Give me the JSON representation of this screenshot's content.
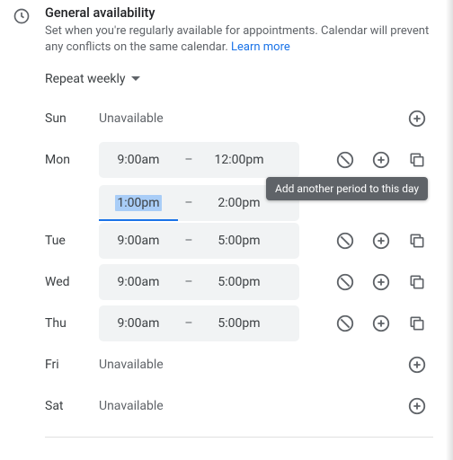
{
  "header": {
    "title": "General availability",
    "subtitle_prefix": "Set when you're regularly available for appointments. Calendar will prevent any conflicts on the same calendar. ",
    "learn_more": "Learn more"
  },
  "repeat": {
    "label": "Repeat weekly"
  },
  "tooltip": {
    "add_period": "Add another period to this day"
  },
  "dash": "–",
  "days": {
    "sun": {
      "label": "Sun",
      "unavailable": "Unavailable"
    },
    "mon": {
      "label": "Mon",
      "periods": [
        {
          "start": "9:00am",
          "end": "12:00pm"
        },
        {
          "start": "1:00pm",
          "end": "2:00pm"
        }
      ]
    },
    "tue": {
      "label": "Tue",
      "periods": [
        {
          "start": "9:00am",
          "end": "5:00pm"
        }
      ]
    },
    "wed": {
      "label": "Wed",
      "periods": [
        {
          "start": "9:00am",
          "end": "5:00pm"
        }
      ]
    },
    "thu": {
      "label": "Thu",
      "periods": [
        {
          "start": "9:00am",
          "end": "5:00pm"
        }
      ]
    },
    "fri": {
      "label": "Fri",
      "unavailable": "Unavailable"
    },
    "sat": {
      "label": "Sat",
      "unavailable": "Unavailable"
    }
  }
}
